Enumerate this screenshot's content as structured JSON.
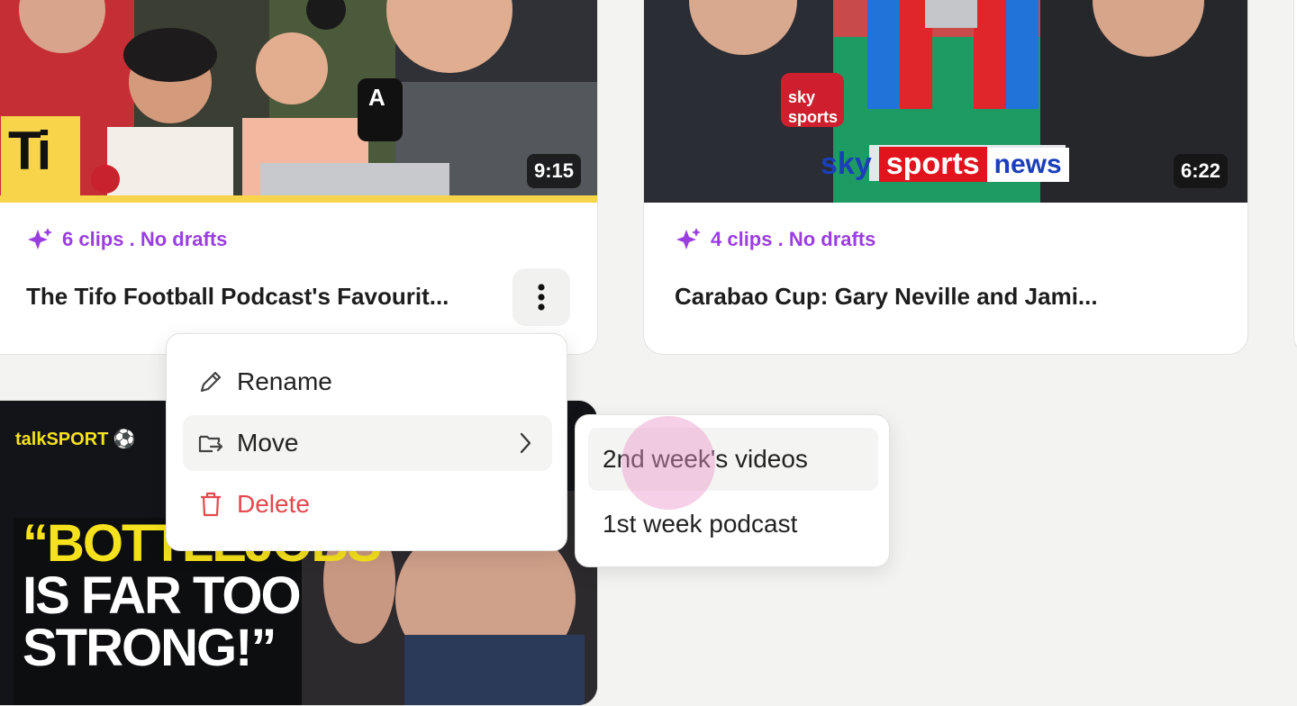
{
  "cards": [
    {
      "duration": "9:15",
      "meta": "6 clips . No drafts",
      "title": "The Tifo Football Podcast's Favourit...",
      "logo_text": "Ti",
      "mic_letter": "A"
    },
    {
      "duration": "6:22",
      "meta": "4 clips . No drafts",
      "title": "Carabao Cup: Gary Neville and Jami...",
      "broadcaster": {
        "sky": "sky",
        "sports": "sports",
        "news": "news"
      },
      "mic_flag": {
        "sky": "sky",
        "sports": "sports"
      }
    },
    {
      "brand": "talkSPORT",
      "headline_lines": [
        "“BOTTLEJOBS",
        "IS FAR TOO",
        "STRONG!”"
      ]
    }
  ],
  "context_menu": {
    "items": [
      {
        "label": "Rename",
        "icon": "pencil-icon"
      },
      {
        "label": "Move",
        "icon": "folder-move-icon"
      },
      {
        "label": "Delete",
        "icon": "trash-icon"
      }
    ]
  },
  "submenu": {
    "items": [
      {
        "label": "2nd week's videos"
      },
      {
        "label": "1st week podcast"
      }
    ]
  },
  "colors": {
    "accent_purple": "#9b3ee0",
    "delete_red": "#e5484d",
    "tifo_yellow": "#f7d44a",
    "cursor_highlight": "#eeb8d8"
  }
}
